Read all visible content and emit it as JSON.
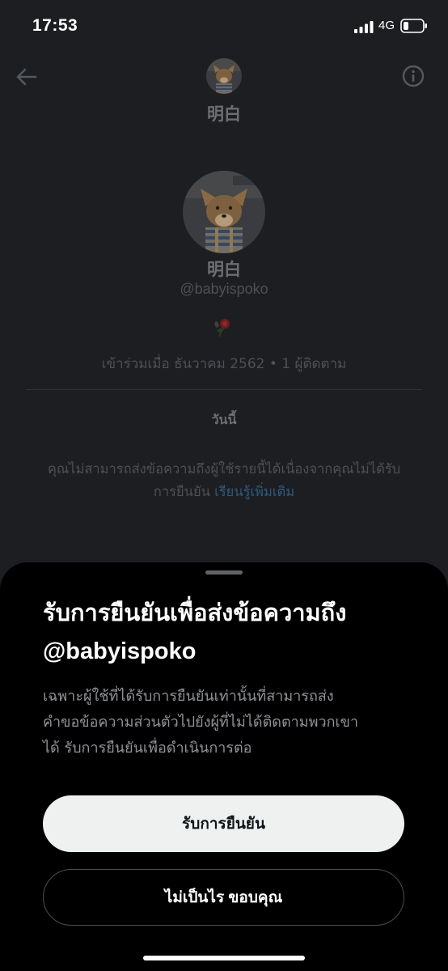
{
  "status_bar": {
    "time": "17:53",
    "network": "4G"
  },
  "header": {
    "name": "明白"
  },
  "profile": {
    "name": "明白",
    "handle": "@babyispoko",
    "joined": "เข้าร่วมเมื่อ ธันวาคม 2562 • 1 ผู้ติดตาม"
  },
  "conversation": {
    "date_label": "วันนี้",
    "notice_line1": "คุณไม่สามารถส่งข้อความถึงผู้ใช้รายนี้ได้เนื่องจากคุณไม่ได้รับ",
    "notice_line2": "การยืนยัน",
    "learn_more": "เรียนรู้เพิ่มเติม"
  },
  "sheet": {
    "title_line1": "รับการยืนยันเพื่อส่งข้อความถึง",
    "title_line2": "@babyispoko",
    "body_line1": "เฉพาะผู้ใช้ที่ได้รับการยืนยันเท่านั้นที่สามารถส่ง",
    "body_line2": "คำขอข้อความส่วนตัวไปยังผู้ที่ไม่ได้ติดตามพวกเขา",
    "body_line3": "ได้ รับการยืนยันเพื่อดำเนินการต่อ",
    "primary_button": "รับการยืนยัน",
    "secondary_button": "ไม่เป็นไร ขอบคุณ"
  },
  "colors": {
    "background_dim": "#1d1e21",
    "sheet": "#000000",
    "primary_button": "#eff1f1",
    "link": "#1d9bf0"
  }
}
